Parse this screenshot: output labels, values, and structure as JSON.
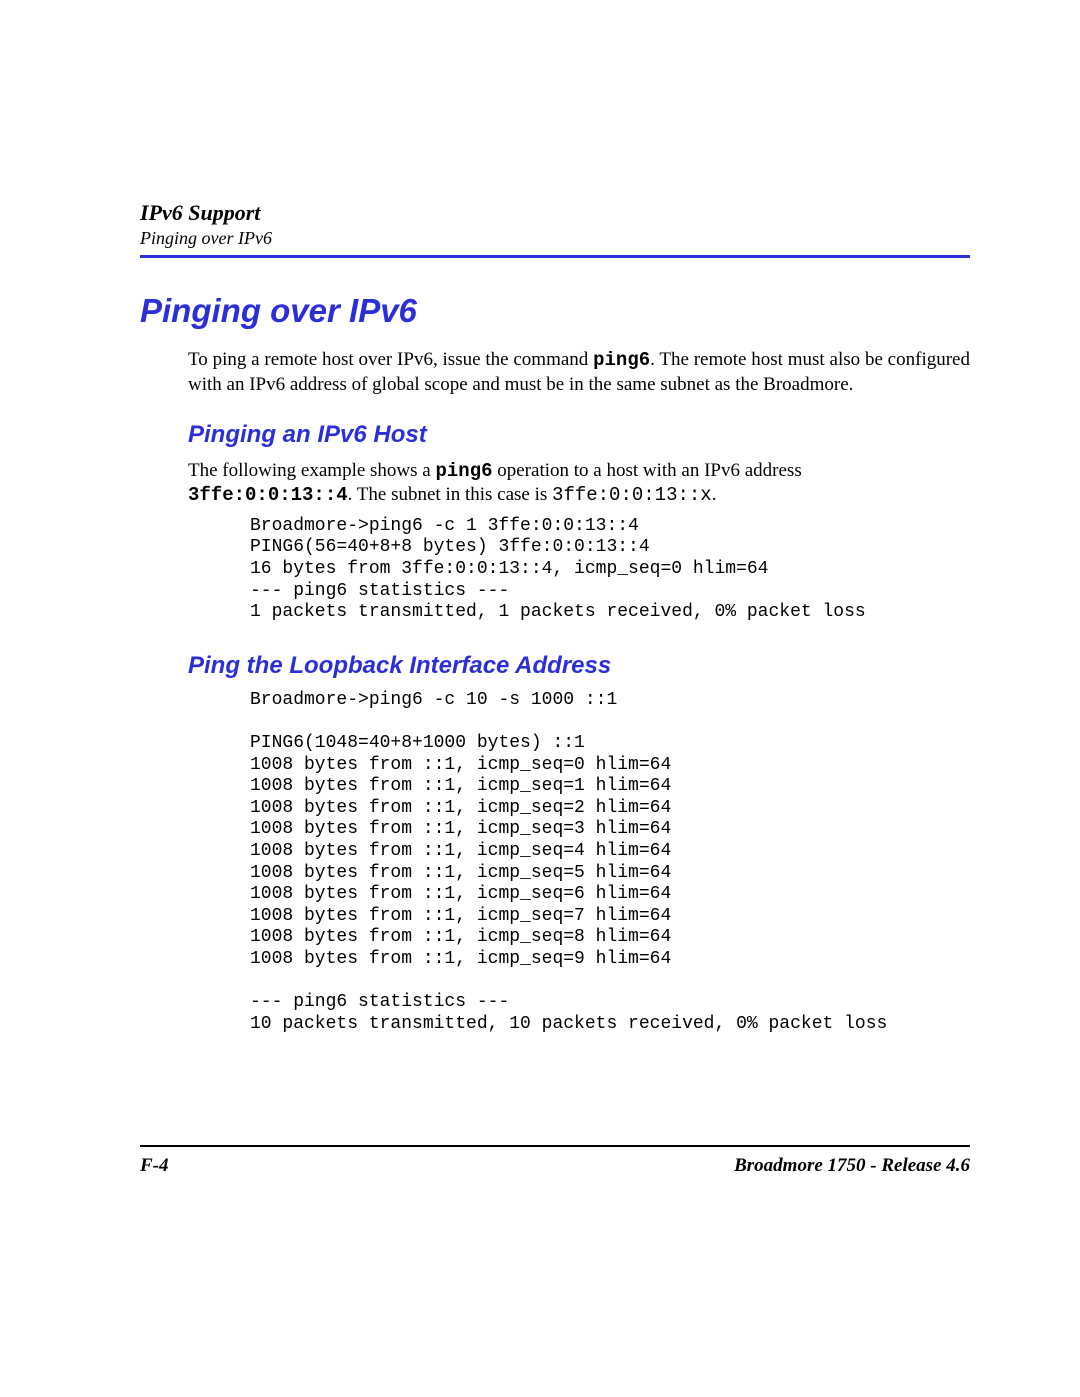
{
  "header": {
    "title": "IPv6 Support",
    "subtitle": "Pinging over IPv6"
  },
  "h1": "Pinging over IPv6",
  "intro": {
    "pre": "To ping a remote host over IPv6, issue the command ",
    "cmd": "ping6",
    "post": ". The remote host must also be configured with an IPv6 address of global scope and must be in the same subnet as the Broadmore."
  },
  "section1": {
    "heading": "Pinging an IPv6 Host",
    "para": {
      "a": "The following example shows a ",
      "cmd1": "ping6",
      "b": " operation to a host with an IPv6 address ",
      "addr": "3ffe:0:0:13::4",
      "c": ". The subnet in this case is ",
      "subnet": "3ffe:0:0:13::x",
      "d": "."
    },
    "code": "Broadmore->ping6 -c 1 3ffe:0:0:13::4\nPING6(56=40+8+8 bytes) 3ffe:0:0:13::4\n16 bytes from 3ffe:0:0:13::4, icmp_seq=0 hlim=64\n--- ping6 statistics ---\n1 packets transmitted, 1 packets received, 0% packet loss"
  },
  "section2": {
    "heading": "Ping the Loopback Interface Address",
    "code": "Broadmore->ping6 -c 10 -s 1000 ::1\n\nPING6(1048=40+8+1000 bytes) ::1\n1008 bytes from ::1, icmp_seq=0 hlim=64\n1008 bytes from ::1, icmp_seq=1 hlim=64\n1008 bytes from ::1, icmp_seq=2 hlim=64\n1008 bytes from ::1, icmp_seq=3 hlim=64\n1008 bytes from ::1, icmp_seq=4 hlim=64\n1008 bytes from ::1, icmp_seq=5 hlim=64\n1008 bytes from ::1, icmp_seq=6 hlim=64\n1008 bytes from ::1, icmp_seq=7 hlim=64\n1008 bytes from ::1, icmp_seq=8 hlim=64\n1008 bytes from ::1, icmp_seq=9 hlim=64\n\n--- ping6 statistics ---\n10 packets transmitted, 10 packets received, 0% packet loss"
  },
  "footer": {
    "left": "F-4",
    "right": "Broadmore 1750 - Release 4.6"
  }
}
